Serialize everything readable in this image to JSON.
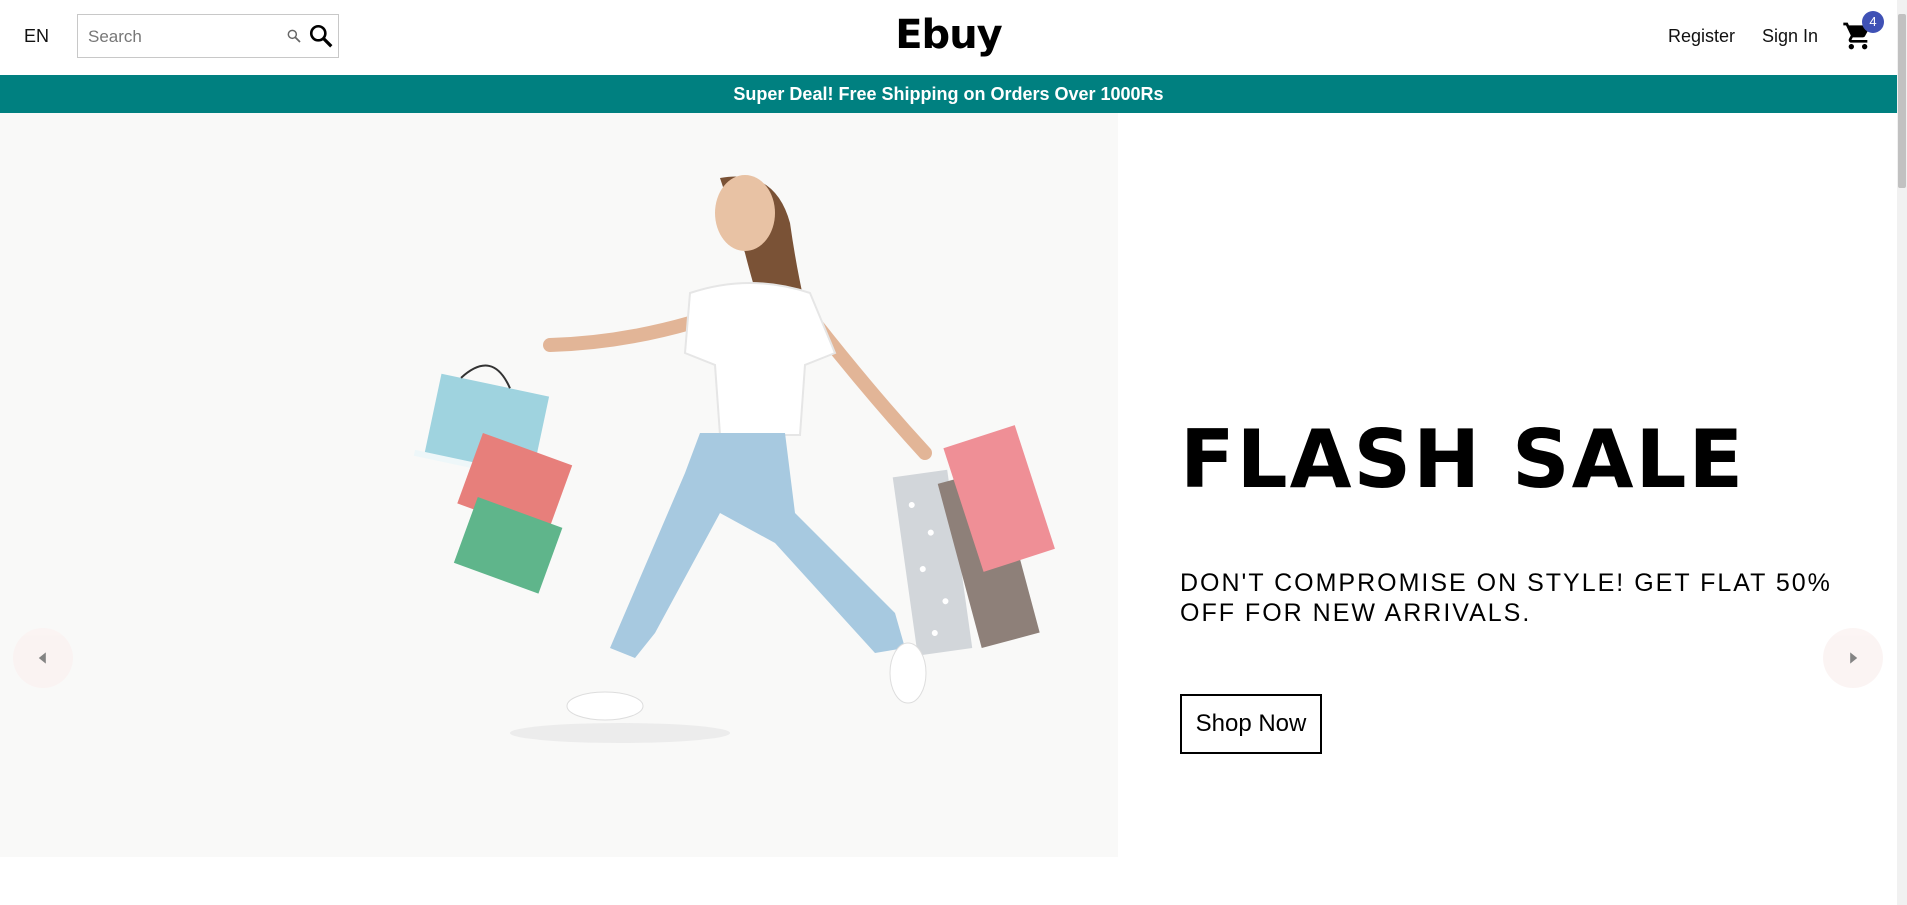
{
  "navbar": {
    "language": "EN",
    "search": {
      "placeholder": "Search",
      "value": ""
    },
    "logo": "Ebuy",
    "links": {
      "register": "Register",
      "sign_in": "Sign In"
    },
    "cart": {
      "icon": "shopping-cart-icon",
      "count": "4"
    }
  },
  "announcement": "Super Deal! Free Shipping on Orders Over 1000Rs",
  "hero": {
    "title": "FLASH SALE",
    "description": "DON'T COMPROMISE ON STYLE! GET FLAT 50% OFF FOR NEW ARRIVALS.",
    "button": "Shop Now",
    "image": "woman-with-shopping-bags-image"
  },
  "colors": {
    "accent": "#008080",
    "badge": "#3f51b5",
    "arrow_bg": "#fbf2f1",
    "hero_bg": "#f9f9f8"
  }
}
